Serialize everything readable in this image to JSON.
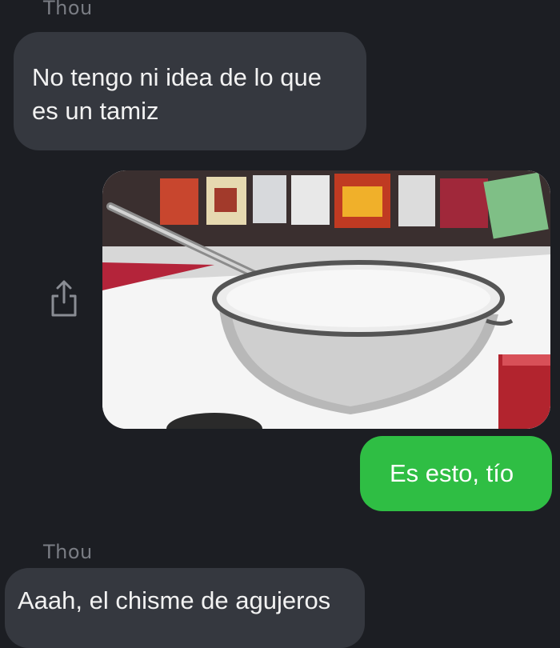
{
  "messages": [
    {
      "sender": "Thou",
      "text": "No tengo ni idea de lo que es un tamiz"
    },
    {
      "text": "Es esto, tío"
    },
    {
      "sender": "Thou",
      "text": "Aaah, el chisme de agujeros"
    }
  ],
  "icons": {
    "share": "share-icon",
    "image": "sieve-photo"
  },
  "colors": {
    "background": "#1c1e23",
    "incoming_bubble": "#35383f",
    "outgoing_bubble": "#2fbe44",
    "text": "#f2f2f2",
    "sender": "#7a7d84"
  }
}
